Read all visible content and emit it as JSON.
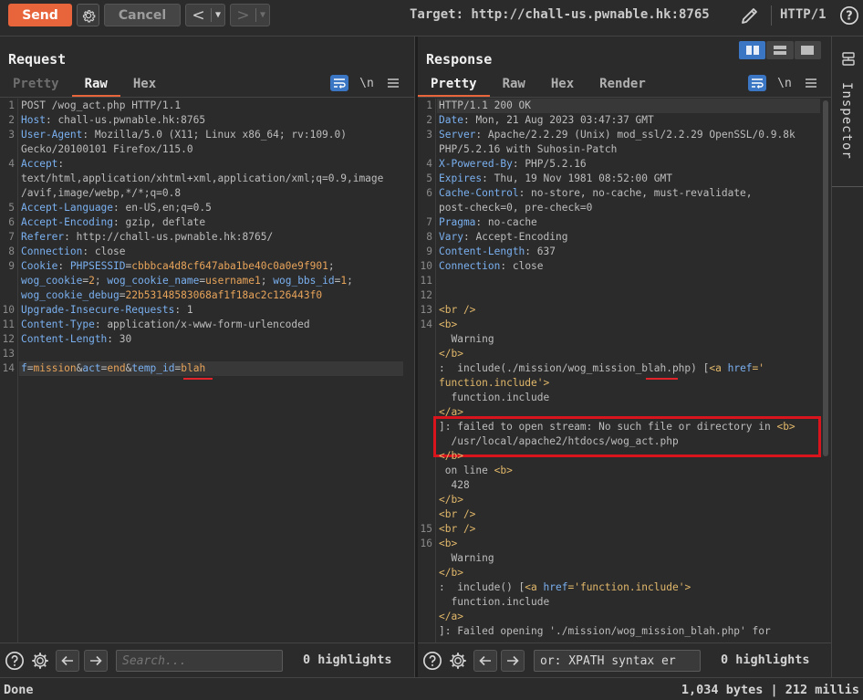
{
  "toolbar": {
    "send_label": "Send",
    "cancel_label": "Cancel",
    "target_label": "Target: http://chall-us.pwnable.hk:8765",
    "http_version": "HTTP/1",
    "help_label": "?"
  },
  "request": {
    "title": "Request",
    "tabs": [
      {
        "label": "Pretty",
        "state": "dim"
      },
      {
        "label": "Raw",
        "state": "active"
      },
      {
        "label": "Hex",
        "state": "normal"
      }
    ],
    "newline_label": "\\n",
    "lines": [
      {
        "no": "1",
        "key": "",
        "sep": "",
        "val": "POST /wog_act.php HTTP/1.1"
      },
      {
        "no": "2",
        "key": "Host",
        "sep": ": ",
        "val": "chall-us.pwnable.hk:8765"
      },
      {
        "no": "3",
        "key": "User-Agent",
        "sep": ": ",
        "val": "Mozilla/5.0 (X11; Linux x86_64; rv:109.0)"
      },
      {
        "no": "",
        "key": "",
        "sep": "",
        "val": "Gecko/20100101 Firefox/115.0"
      },
      {
        "no": "4",
        "key": "Accept",
        "sep": ":",
        "val": ""
      },
      {
        "no": "",
        "key": "",
        "sep": "",
        "val": "text/html,application/xhtml+xml,application/xml;q=0.9,image"
      },
      {
        "no": "",
        "key": "",
        "sep": "",
        "val": "/avif,image/webp,*/*;q=0.8"
      },
      {
        "no": "5",
        "key": "Accept-Language",
        "sep": ": ",
        "val": "en-US,en;q=0.5"
      },
      {
        "no": "6",
        "key": "Accept-Encoding",
        "sep": ": ",
        "val": "gzip, deflate"
      },
      {
        "no": "7",
        "key": "Referer",
        "sep": ": ",
        "val": "http://chall-us.pwnable.hk:8765/"
      },
      {
        "no": "8",
        "key": "Connection",
        "sep": ": ",
        "val": "close"
      }
    ],
    "cookie": {
      "no": "9",
      "key": "Cookie",
      "p1k": "PHPSESSID",
      "p1v": "cbbbca4d8cf647aba1be40c0a0e9f901",
      "p2k": "wog_cookie",
      "p2v": "2",
      "p3k": "wog_cookie_name",
      "p3v": "username1",
      "p4k": "wog_bbs_id",
      "p4v": "1",
      "p5k": "wog_cookie_debug",
      "p5v": "22b53148583068af1f18ac2c126443f0"
    },
    "lines2": [
      {
        "no": "10",
        "key": "Upgrade-Insecure-Requests",
        "sep": ": ",
        "val": "1"
      },
      {
        "no": "11",
        "key": "Content-Type",
        "sep": ": ",
        "val": "application/x-www-form-urlencoded"
      },
      {
        "no": "12",
        "key": "Content-Length",
        "sep": ": ",
        "val": "30"
      },
      {
        "no": "13",
        "key": "",
        "sep": "",
        "val": ""
      }
    ],
    "body": {
      "no": "14",
      "p1k": "f",
      "p1v": "mission",
      "p2k": "act",
      "p2v": "end",
      "p3k": "temp_id",
      "p3v": "blah"
    },
    "search_placeholder": "Search...",
    "highlights": "0 highlights"
  },
  "response": {
    "title": "Response",
    "tabs": [
      {
        "label": "Pretty",
        "state": "active"
      },
      {
        "label": "Raw",
        "state": "normal"
      },
      {
        "label": "Hex",
        "state": "normal"
      },
      {
        "label": "Render",
        "state": "normal"
      }
    ],
    "newline_label": "\\n",
    "headers": [
      {
        "no": "1",
        "key": "",
        "sep": "",
        "val": "HTTP/1.1 200 OK"
      },
      {
        "no": "2",
        "key": "Date",
        "sep": ": ",
        "val": "Mon, 21 Aug 2023 03:47:37 GMT"
      },
      {
        "no": "3",
        "key": "Server",
        "sep": ": ",
        "val": "Apache/2.2.29 (Unix) mod_ssl/2.2.29 OpenSSL/0.9.8k"
      },
      {
        "no": "",
        "key": "",
        "sep": "",
        "val": "PHP/5.2.16 with Suhosin-Patch"
      },
      {
        "no": "4",
        "key": "X-Powered-By",
        "sep": ": ",
        "val": "PHP/5.2.16"
      },
      {
        "no": "5",
        "key": "Expires",
        "sep": ": ",
        "val": "Thu, 19 Nov 1981 08:52:00 GMT"
      },
      {
        "no": "6",
        "key": "Cache-Control",
        "sep": ": ",
        "val": "no-store, no-cache, must-revalidate,"
      },
      {
        "no": "",
        "key": "",
        "sep": "",
        "val": "post-check=0, pre-check=0"
      },
      {
        "no": "7",
        "key": "Pragma",
        "sep": ": ",
        "val": "no-cache"
      },
      {
        "no": "8",
        "key": "Vary",
        "sep": ": ",
        "val": "Accept-Encoding"
      },
      {
        "no": "9",
        "key": "Content-Length",
        "sep": ": ",
        "val": "637"
      },
      {
        "no": "10",
        "key": "Connection",
        "sep": ": ",
        "val": "close"
      },
      {
        "no": "11",
        "key": "Content-Type",
        "sep": ": ",
        "val": "text/html"
      },
      {
        "no": "12",
        "key": "",
        "sep": "",
        "val": ""
      }
    ],
    "html": {
      "br": "<br />",
      "b_open": "<b>",
      "b_close": "</b>",
      "a_close": "</a>",
      "warning": "  Warning",
      "include1_pre": ":  include(./mission/wog_mission_blah.php) [",
      "a_open_tag": "<a ",
      "href_attr": "href",
      "href_eq": "='",
      "href_val_1": "'",
      "href_val_2": "function.include'",
      "gt": ">",
      "func_include": "  function.include",
      "failed_open": "]: failed to open stream: No such file or directory in ",
      "path": "  /usr/local/apache2/htdocs/wog_act.php",
      "on_line": " on line ",
      "line_num": "  428",
      "include2_pre": ":  include() [",
      "href_val_full": "'function.include'",
      "failed_opening": "]: Failed opening './mission/wog_mission_blah.php' for",
      "ln13": "13",
      "ln14": "14",
      "ln15": "15",
      "ln16": "16"
    },
    "search_value": "or: XPATH syntax er",
    "highlights": "0 highlights"
  },
  "inspector": {
    "label": "Inspector"
  },
  "status": {
    "left": "Done",
    "right": "1,034 bytes | 212 millis"
  },
  "colors": {
    "accent": "#e8643a",
    "selected_blue": "#3b76c4",
    "highlight_red": "#d9141c"
  },
  "icons": [
    "gear-icon",
    "pencil-icon",
    "help-icon",
    "wrap-icon",
    "menu-icon",
    "arrow-left-icon",
    "arrow-right-icon",
    "inspector-icon"
  ]
}
